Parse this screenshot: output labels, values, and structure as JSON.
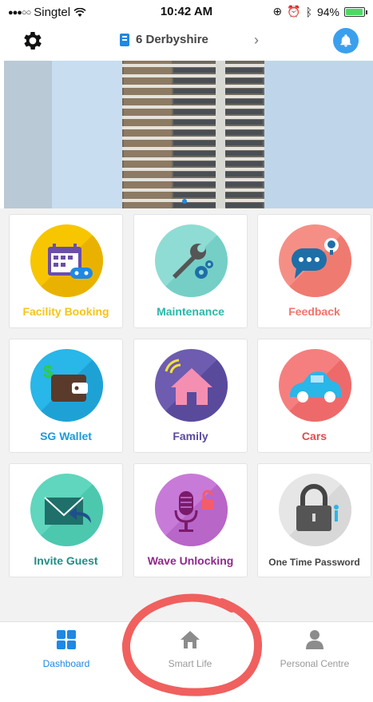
{
  "status_bar": {
    "carrier": "Singtel",
    "time": "10:42 AM",
    "battery": "94%",
    "battery_level": 0.94
  },
  "nav": {
    "title": "6 Derbyshire",
    "chevron": "›",
    "left_icon": "gear-icon",
    "right_icon": "bell-icon"
  },
  "tiles": [
    {
      "label": "Facility Booking",
      "color": "#f5c518",
      "icon": "calendar-icon"
    },
    {
      "label": "Maintenance",
      "color": "#2ab7a9",
      "icon": "wrench-icon"
    },
    {
      "label": "Feedback",
      "color": "#f4736a",
      "icon": "chat-bubble-icon"
    },
    {
      "label": "SG Wallet",
      "color": "#1e9ad6",
      "icon": "wallet-icon"
    },
    {
      "label": "Family",
      "color": "#5b4a9e",
      "icon": "house-icon"
    },
    {
      "label": "Cars",
      "color": "#e14b4b",
      "icon": "car-icon"
    },
    {
      "label": "Invite Guest",
      "color": "#1f8f86",
      "icon": "envelope-icon"
    },
    {
      "label": "Wave Unlocking",
      "color": "#8e2a8c",
      "icon": "microphone-icon"
    },
    {
      "label": "One Time Password",
      "color": "#444444",
      "icon": "padlock-icon"
    }
  ],
  "tabs": [
    {
      "label": "Dashboard",
      "icon": "grid-icon",
      "active": true
    },
    {
      "label": "Smart Life",
      "icon": "home-icon",
      "active": false
    },
    {
      "label": "Personal Centre",
      "icon": "person-icon",
      "active": false
    }
  ],
  "accent": "#1e88e5"
}
